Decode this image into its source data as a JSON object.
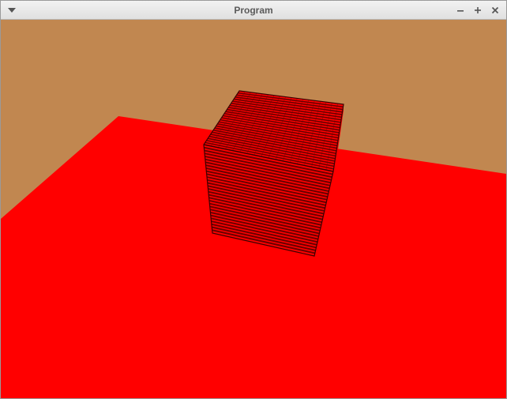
{
  "window": {
    "title": "Program",
    "icons": {
      "menu": "chevron-down-icon",
      "minimize": "minimize-icon",
      "maximize": "maximize-icon",
      "close": "close-icon"
    }
  },
  "scene": {
    "colors": {
      "background": "#c18750",
      "floor": "#ff0000",
      "cube_face": "#ff0000",
      "cube_stripe": "#6a0000",
      "cube_edge": "#3a0000"
    }
  }
}
